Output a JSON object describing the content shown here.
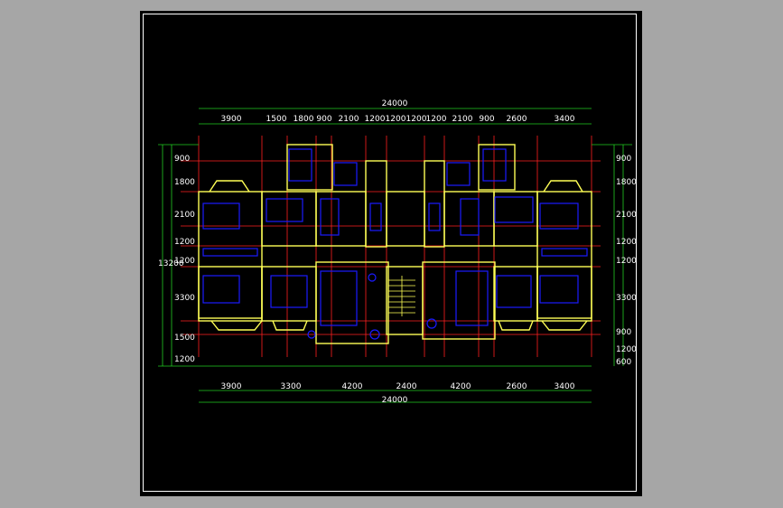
{
  "drawing": {
    "top_total": "24000",
    "bottom_total": "24000",
    "top_dims": [
      "3900",
      "1500",
      "1800",
      "900",
      "2100",
      "1200",
      "1200",
      "1200",
      "1200",
      "2100",
      "900",
      "2600",
      "3400"
    ],
    "bottom_dims": [
      "3900",
      "3300",
      "4200",
      "2400",
      "4200",
      "2600",
      "3400"
    ],
    "left_dims": [
      "900",
      "1800",
      "2100",
      "1200",
      "1200",
      "3300",
      "1500",
      "1200"
    ],
    "left_total": "13200",
    "right_dims": [
      "900",
      "1800",
      "2100",
      "1200",
      "1200",
      "3300",
      "900",
      "1200",
      "600"
    ]
  },
  "colors": {
    "background": "#a6a6a6",
    "paper": "#000000",
    "walls": "#ffff55",
    "furniture": "#1a1aff",
    "grid": "#ff2020",
    "dimension_lines": "#22cc22",
    "text": "#ffffff"
  }
}
